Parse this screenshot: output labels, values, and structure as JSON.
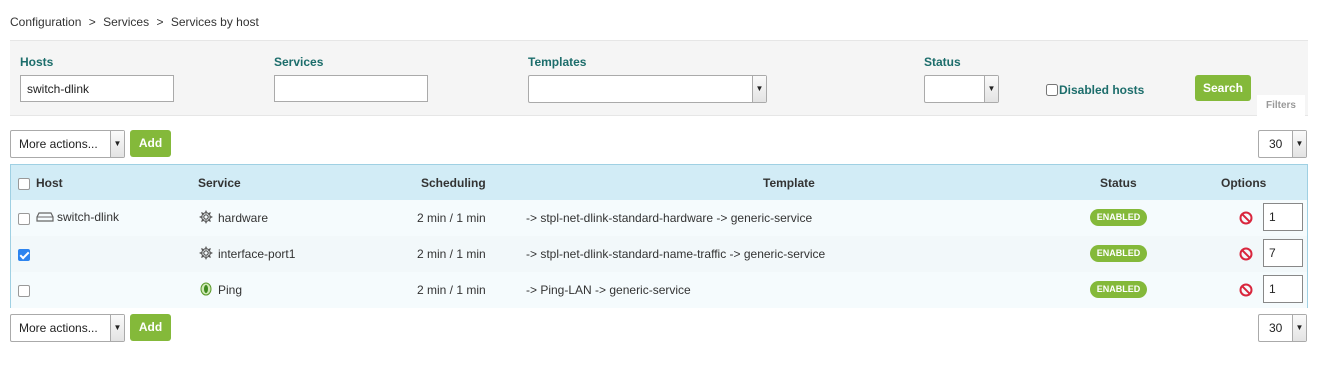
{
  "breadcrumb": [
    "Configuration",
    ">",
    "Services",
    ">",
    "Services by host"
  ],
  "filters": {
    "hosts_label": "Hosts",
    "hosts_value": "switch-dlink",
    "services_label": "Services",
    "services_value": "",
    "templates_label": "Templates",
    "templates_value": "",
    "status_label": "Status",
    "status_value": "",
    "disabled_hosts_label": "Disabled hosts",
    "search_label": "Search",
    "filters_tab": "Filters"
  },
  "toolbar": {
    "more_actions": "More actions...",
    "add_label": "Add",
    "per_page": "30"
  },
  "table": {
    "columns": {
      "host": "Host",
      "service": "Service",
      "scheduling": "Scheduling",
      "template": "Template",
      "status": "Status",
      "options": "Options"
    },
    "rows": [
      {
        "host": "switch-dlink",
        "service": "hardware",
        "service_icon": "gear-icon",
        "scheduling": "2 min / 1 min",
        "template": "-> stpl-net-dlink-standard-hardware -> generic-service",
        "status": "ENABLED",
        "option_value": "1",
        "checked": false
      },
      {
        "host": "",
        "service": "interface-port1",
        "service_icon": "gear-icon",
        "scheduling": "2 min / 1 min",
        "template": "-> stpl-net-dlink-standard-name-traffic -> generic-service",
        "status": "ENABLED",
        "option_value": "7",
        "checked": true
      },
      {
        "host": "",
        "service": "Ping",
        "service_icon": "ping-icon",
        "scheduling": "2 min / 1 min",
        "template": "-> Ping-LAN -> generic-service",
        "status": "ENABLED",
        "option_value": "1",
        "checked": false
      }
    ]
  },
  "colors": {
    "accent_green": "#84b93a",
    "label_teal": "#1c6d6b",
    "header_blue": "#d2ecf6",
    "disable_red": "#d9263d"
  }
}
